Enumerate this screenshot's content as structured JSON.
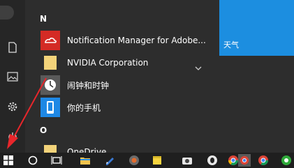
{
  "start_menu": {
    "sections": [
      {
        "letter": "N",
        "apps": [
          {
            "label": "Notification Manager for Adobe...",
            "icon": "adobe-cc-icon",
            "has_expand": false
          },
          {
            "label": "NVIDIA Corporation",
            "icon": "folder-icon",
            "has_expand": true
          },
          {
            "label": "闹钟和时钟",
            "icon": "clock-icon",
            "has_expand": false
          },
          {
            "label": "你的手机",
            "icon": "phone-icon",
            "has_expand": false
          }
        ]
      },
      {
        "letter": "O",
        "apps": [
          {
            "label": "OneDrive",
            "icon": "folder-icon",
            "has_expand": false
          }
        ]
      }
    ],
    "rail_icons": [
      "avatar",
      "document-icon",
      "pictures-icon",
      "settings-icon",
      "power-icon"
    ],
    "tile": {
      "label": "天气",
      "color": "#1c8ee0"
    }
  },
  "taskbar": {
    "items": [
      "windows-start-icon",
      "search-icon",
      "task-view-icon",
      "file-explorer-icon",
      "pen-app-icon",
      "chrome-like-icon",
      "sticky-notes-icon",
      "camera-app-icon",
      "qq-icon",
      "chrome-icon",
      "chrome-active-icon",
      "chrome-icon",
      "green-app-icon"
    ]
  },
  "annotation": {
    "arrow_color": "#e8262b"
  }
}
